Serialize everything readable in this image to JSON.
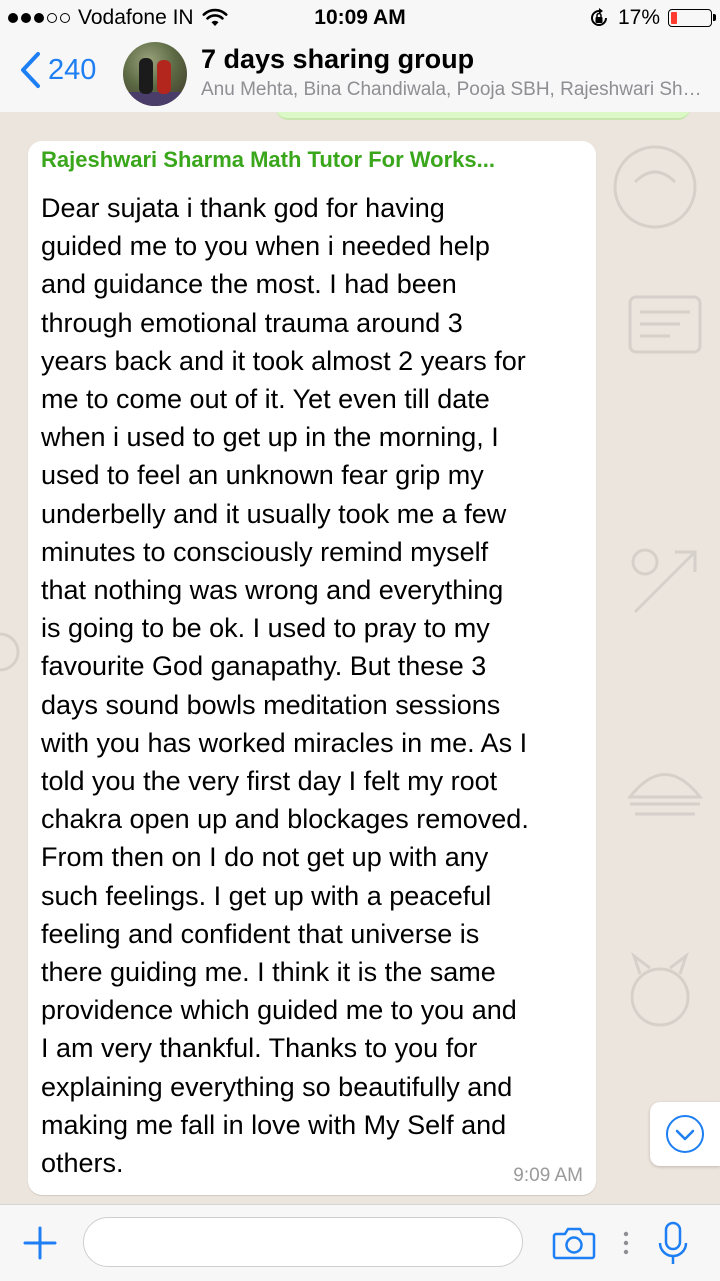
{
  "status_bar": {
    "carrier": "Vodafone IN",
    "time": "10:09 AM",
    "battery_percent": "17%",
    "battery_level": 0.17,
    "battery_color": "#ff3b30",
    "icons": [
      "signal-dots-icon",
      "wifi-icon",
      "orientation-lock-icon",
      "battery-icon"
    ]
  },
  "header": {
    "back_count": "240",
    "group_name": "7 days sharing group",
    "members": "Anu Mehta, Bina Chandiwala, Pooja SBH, Rajeshwari Sharma Math Tutor For Works…"
  },
  "message": {
    "sender": "Rajeshwari Sharma Math Tutor For Works...",
    "sender_color": "#3aa61c",
    "text": "Dear sujata i thank god for having\nguided me to you when i needed help\nand guidance the most. I had been\nthrough emotional trauma around 3\nyears back and it took almost 2 years for\nme to come out of it. Yet even till date\nwhen i used to get up in the morning, I\nused to feel an unknown fear grip my\nunderbelly  and it usually took me a few\nminutes to consciously remind myself\nthat nothing was wrong and everything\nis going to be ok. I used to pray to  my\nfavourite God ganapathy.   But these 3\ndays sound bowls meditation sessions\nwith you has worked miracles in me.  As I\ntold you the very first day I felt my root\nchakra open up and blockages removed.\nFrom then on I do not get up with any\nsuch feelings. I get up with a peaceful\nfeeling and confident that universe is\nthere guiding me. I think it is the same\nprovidence which guided me to you and\nI am very thankful. Thanks to you for\nexplaining everything so beautifully and\nmaking me fall in love with My Self and\nothers.",
    "time": "9:09 AM"
  },
  "input_bar": {
    "placeholder": ""
  },
  "colors": {
    "accent_blue": "#1d7ff3",
    "chat_background": "#ece5dd",
    "outgoing_bubble": "#dcf8c6"
  }
}
